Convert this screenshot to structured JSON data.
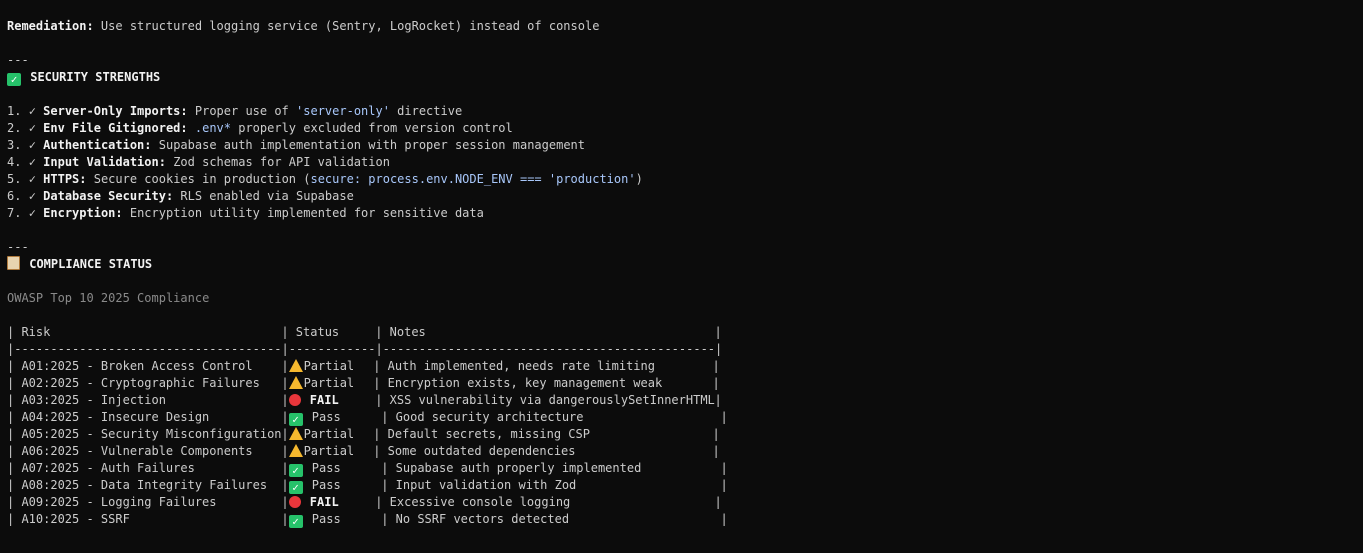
{
  "remediation": {
    "label": "Remediation:",
    "text": " Use structured logging service (Sentry, LogRocket) instead of console"
  },
  "sep1": "---",
  "strengths": {
    "heading": "SECURITY STRENGTHS",
    "icon": "check-box-icon",
    "items": [
      {
        "num": "1. ",
        "check": "✓",
        "title": "Server-Only Imports:",
        "pre": " Proper use of ",
        "code": "'server-only'",
        "post": " directive"
      },
      {
        "num": "2. ",
        "check": "✓",
        "title": "Env File Gitignored:",
        "pre": " ",
        "code": ".env*",
        "post": " properly excluded from version control"
      },
      {
        "num": "3. ",
        "check": "✓",
        "title": "Authentication:",
        "pre": " Supabase auth implementation with proper session management",
        "code": "",
        "post": ""
      },
      {
        "num": "4. ",
        "check": "✓",
        "title": "Input Validation:",
        "pre": " Zod schemas for API validation",
        "code": "",
        "post": ""
      },
      {
        "num": "5. ",
        "check": "✓",
        "title": "HTTPS:",
        "pre": " Secure cookies in production (",
        "code": "secure: process.env.NODE_ENV === 'production'",
        "post": ")"
      },
      {
        "num": "6. ",
        "check": "✓",
        "title": "Database Security:",
        "pre": " RLS enabled via Supabase",
        "code": "",
        "post": ""
      },
      {
        "num": "7. ",
        "check": "✓",
        "title": "Encryption:",
        "pre": " Encryption utility implemented for sensitive data",
        "code": "",
        "post": ""
      }
    ]
  },
  "sep2": "---",
  "compliance": {
    "heading": "COMPLIANCE STATUS",
    "icon": "clipboard-icon",
    "subtitle": "OWASP Top 10 2025 Compliance",
    "header": {
      "risk": " Risk",
      "status": " Status",
      "notes": " Notes"
    },
    "divider": "|-------------------------------------|------------|----------------------------------------------|",
    "rows": [
      {
        "risk": " A01:2025 - Broken Access Control",
        "status_icon": "warn",
        "status": "Partial",
        "notes": " Auth implemented, needs rate limiting"
      },
      {
        "risk": " A02:2025 - Cryptographic Failures",
        "status_icon": "warn",
        "status": "Partial",
        "notes": " Encryption exists, key management weak"
      },
      {
        "risk": " A03:2025 - Injection",
        "status_icon": "red",
        "status": "FAIL",
        "notes": " XSS vulnerability via dangerouslySetInnerHTML"
      },
      {
        "risk": " A04:2025 - Insecure Design",
        "status_icon": "green",
        "status": "Pass",
        "notes": " Good security architecture"
      },
      {
        "risk": " A05:2025 - Security Misconfiguration",
        "status_icon": "warn",
        "status": "Partial",
        "notes": " Default secrets, missing CSP"
      },
      {
        "risk": " A06:2025 - Vulnerable Components",
        "status_icon": "warn",
        "status": "Partial",
        "notes": " Some outdated dependencies"
      },
      {
        "risk": " A07:2025 - Auth Failures",
        "status_icon": "green",
        "status": "Pass",
        "notes": " Supabase auth properly implemented"
      },
      {
        "risk": " A08:2025 - Data Integrity Failures",
        "status_icon": "green",
        "status": "Pass",
        "notes": " Input validation with Zod"
      },
      {
        "risk": " A09:2025 - Logging Failures",
        "status_icon": "red",
        "status": "FAIL",
        "notes": " Excessive console logging"
      },
      {
        "risk": " A10:2025 - SSRF",
        "status_icon": "green",
        "status": "Pass",
        "notes": " No SSRF vectors detected"
      }
    ]
  }
}
